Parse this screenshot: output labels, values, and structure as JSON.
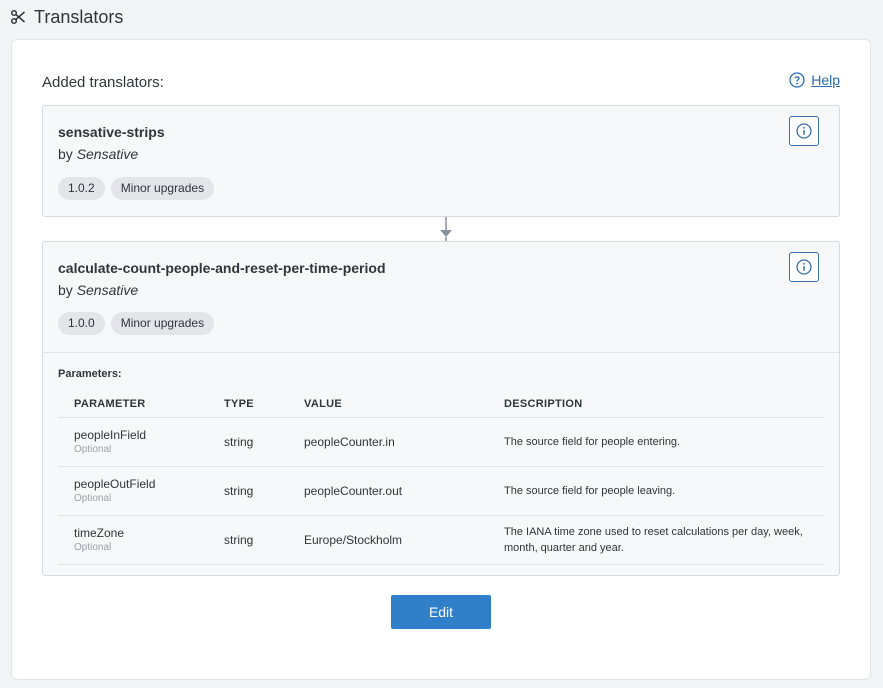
{
  "header": {
    "title": "Translators",
    "icon": "scissors-icon"
  },
  "section": {
    "label": "Added translators:",
    "help_label": "Help"
  },
  "translators": [
    {
      "name": "sensative-strips",
      "by_prefix": "by",
      "author": "Sensative",
      "version": "1.0.2",
      "upgrade_policy": "Minor upgrades"
    },
    {
      "name": "calculate-count-people-and-reset-per-time-period",
      "by_prefix": "by",
      "author": "Sensative",
      "version": "1.0.0",
      "upgrade_policy": "Minor upgrades",
      "parameters_label": "Parameters:",
      "columns": [
        "PARAMETER",
        "TYPE",
        "VALUE",
        "DESCRIPTION"
      ],
      "parameters": [
        {
          "name": "peopleInField",
          "optional": "Optional",
          "type": "string",
          "value": "peopleCounter.in",
          "description": "The source field for people entering."
        },
        {
          "name": "peopleOutField",
          "optional": "Optional",
          "type": "string",
          "value": "peopleCounter.out",
          "description": "The source field for people leaving."
        },
        {
          "name": "timeZone",
          "optional": "Optional",
          "type": "string",
          "value": "Europe/Stockholm",
          "description": "The IANA time zone used to reset calculations per day, week, month, quarter and year."
        }
      ]
    }
  ],
  "actions": {
    "edit_label": "Edit"
  },
  "colors": {
    "accent": "#2f80c8",
    "link": "#2b6cb0",
    "card_bg": "#f7f8f9",
    "page_bg": "#f3f4f6"
  }
}
